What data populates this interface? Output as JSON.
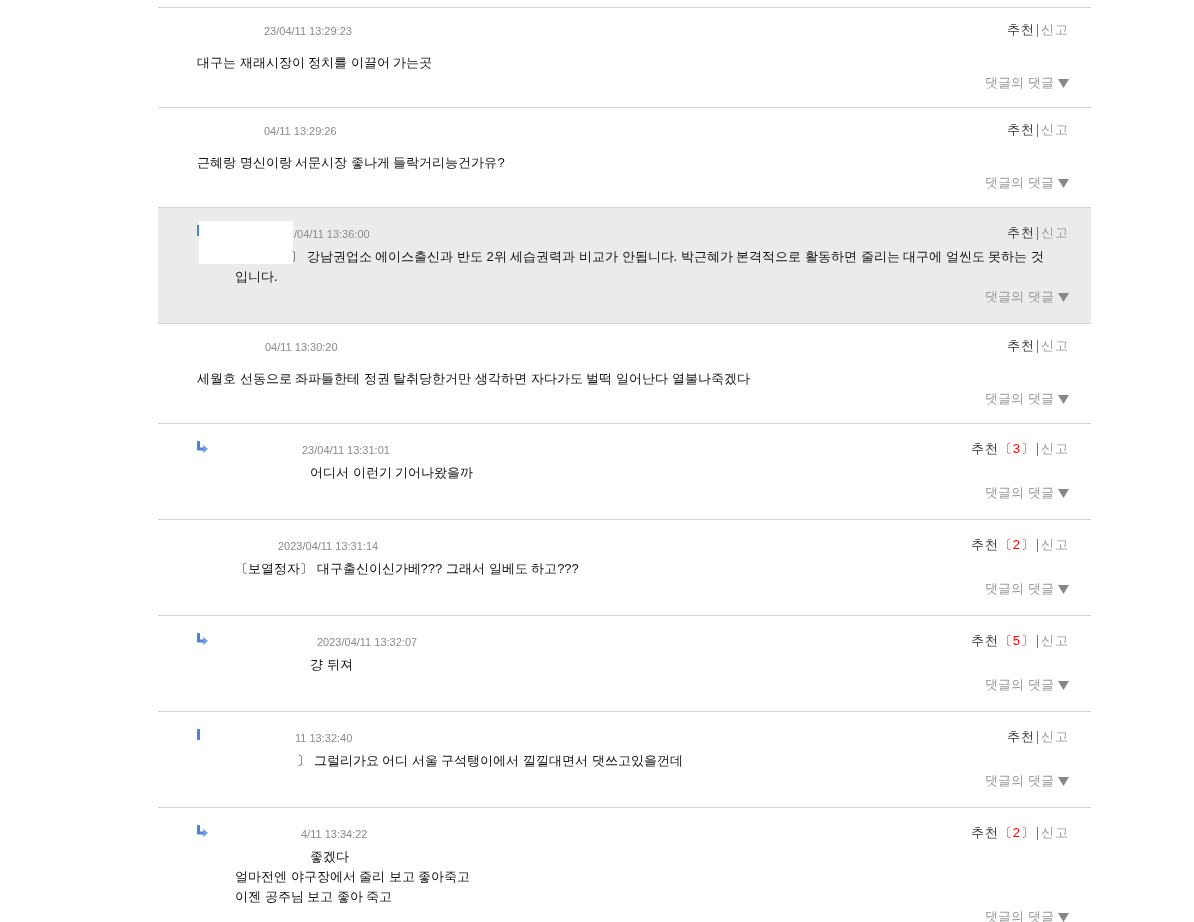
{
  "comments": [
    {
      "kind": "comment",
      "arrow": false,
      "highlighted": false,
      "redacted": false,
      "date": "23/04/11 13:29:23",
      "text": "대구는 재래시장이 정치를 이끌어 가는곳",
      "recommend": "추천",
      "report": "신고",
      "reply_toggle": "댓글의 댓글"
    },
    {
      "kind": "comment",
      "arrow": false,
      "highlighted": false,
      "redacted": false,
      "date": "04/11 13:29:26",
      "text": "근혜랑 명신이랑 서문시장 좋나게 들락거리능건가유?",
      "recommend": "추천",
      "report": "신고",
      "reply_toggle": "댓글의 댓글"
    },
    {
      "kind": "reply",
      "arrow": true,
      "arrow_cut": true,
      "highlighted": true,
      "redacted": true,
      "date": "/04/11 13:36:00",
      "text": "〕 강남권업소 에이스출신과 반도 2위 세습권력과 비교가 안됩니다. 박근혜가 본격적으로 활동하면 줄리는 대구에 얼씬도 못하는 것입니다.",
      "recommend": "추천",
      "report": "신고",
      "reply_toggle": "댓글의 댓글"
    },
    {
      "kind": "comment",
      "arrow": false,
      "highlighted": false,
      "redacted": false,
      "date": "04/11 13:30:20",
      "text": "세월호 선동으로 좌파들한테 정권 탈취당한거만 생각하면 자다가도 벌떡 일어난다 열불나죽겠다",
      "recommend": "추천",
      "report": "신고",
      "reply_toggle": "댓글의 댓글"
    },
    {
      "kind": "reply",
      "arrow": true,
      "arrow_cut": false,
      "highlighted": false,
      "redacted": false,
      "date": "23/04/11 13:31:01",
      "text": "어디서 이런기 기어나왔을까",
      "recommend": "추천",
      "count": "〔3〕",
      "report": "신고",
      "reply_toggle": "댓글의 댓글"
    },
    {
      "kind": "reply",
      "arrow": false,
      "highlighted": false,
      "redacted": false,
      "date": "2023/04/11 13:31:14",
      "text": "〔보열정자〕 대구출신이신가베??? 그래서 일베도 하고???",
      "recommend": "추천",
      "count": "〔2〕",
      "report": "신고",
      "reply_toggle": "댓글의 댓글"
    },
    {
      "kind": "reply",
      "arrow": true,
      "arrow_cut": false,
      "highlighted": false,
      "redacted": false,
      "date": "2023/04/11 13:32:07",
      "text": "걍 뒤져",
      "recommend": "추천",
      "count": "〔5〕",
      "report": "신고",
      "reply_toggle": "댓글의 댓글"
    },
    {
      "kind": "reply",
      "arrow": true,
      "arrow_cut": true,
      "highlighted": false,
      "redacted": false,
      "date": "11 13:32:40",
      "text": "〕 그럴리가요 어디 서울 구석탱이에서 낄낄대면서 댓쓰고있을껀데",
      "recommend": "추천",
      "report": "신고",
      "reply_toggle": "댓글의 댓글"
    },
    {
      "kind": "reply",
      "arrow": true,
      "arrow_cut": false,
      "highlighted": false,
      "redacted": false,
      "date": "4/11 13:34:22",
      "text": "좋겠다\n얼마전엔 야구장에서 줄리 보고 좋아죽고\n이젠 공주님 보고 좋아 죽고",
      "recommend": "추천",
      "count": "〔2〕",
      "report": "신고",
      "reply_toggle": "댓글의 댓글"
    }
  ]
}
